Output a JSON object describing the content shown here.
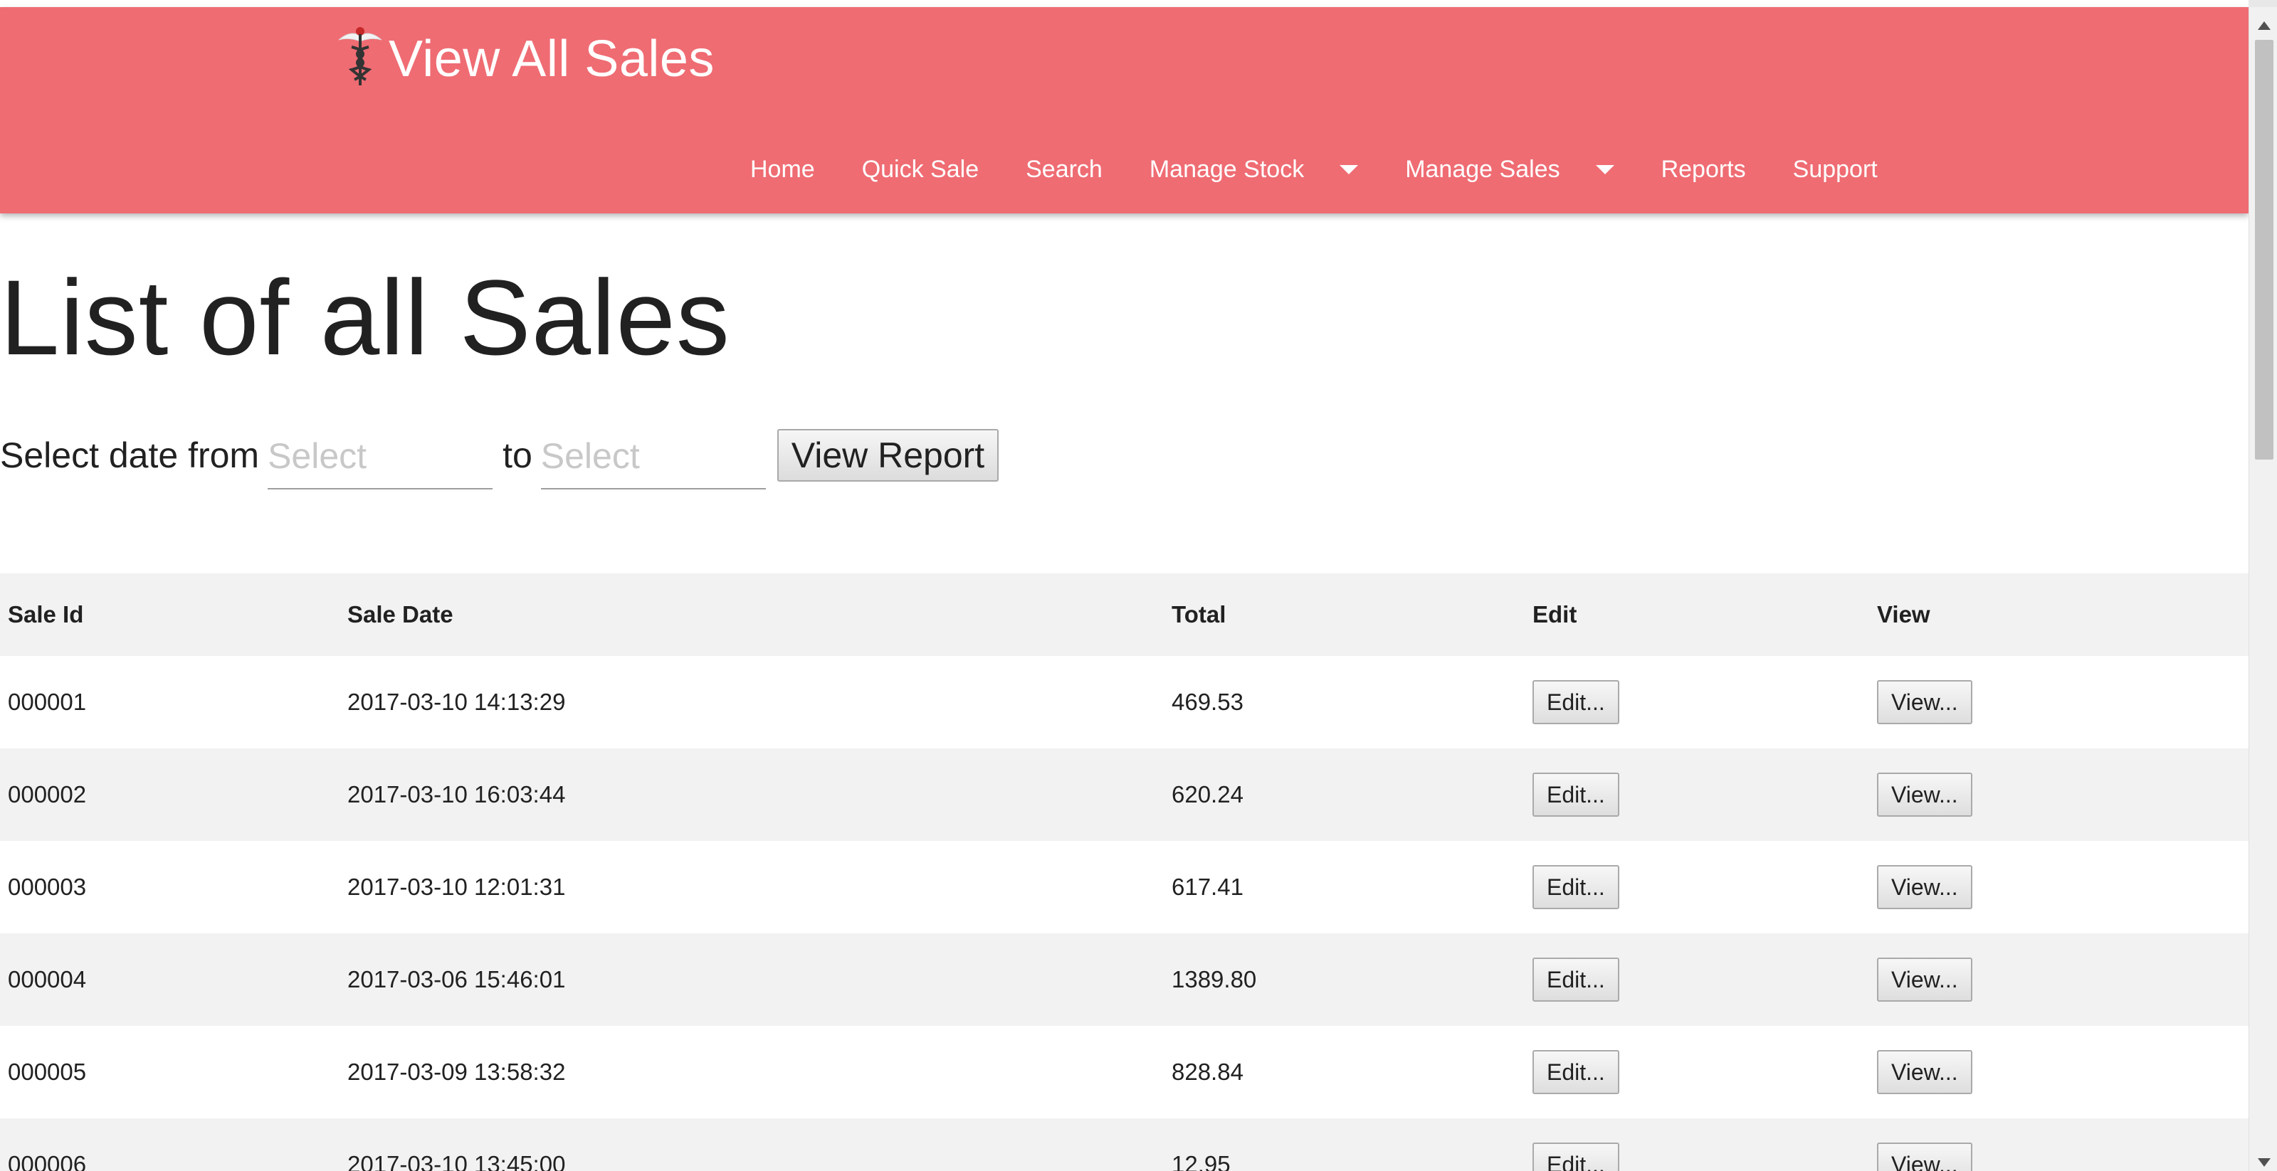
{
  "header": {
    "title": "View All Sales",
    "logo_icon": "caduceus-icon",
    "bg_color": "#ef6c73"
  },
  "nav": {
    "items": [
      {
        "label": "Home"
      },
      {
        "label": "Quick Sale"
      },
      {
        "label": "Search"
      },
      {
        "label": "Manage Stock",
        "dropdown": true
      },
      {
        "label": "Manage Sales",
        "dropdown": true
      },
      {
        "label": "Reports"
      },
      {
        "label": "Support"
      }
    ]
  },
  "main": {
    "heading": "List of all Sales",
    "filter": {
      "label_from": "Select date from",
      "from_placeholder": "Select",
      "label_to": "to",
      "to_placeholder": "Select",
      "button_label": "View Report"
    }
  },
  "table": {
    "columns": [
      "Sale Id",
      "Sale Date",
      "Total",
      "Edit",
      "View"
    ],
    "edit_label": "Edit...",
    "view_label": "View...",
    "rows": [
      {
        "id": "000001",
        "date": "2017-03-10 14:13:29",
        "total": "469.53"
      },
      {
        "id": "000002",
        "date": "2017-03-10 16:03:44",
        "total": "620.24"
      },
      {
        "id": "000003",
        "date": "2017-03-10 12:01:31",
        "total": "617.41"
      },
      {
        "id": "000004",
        "date": "2017-03-06 15:46:01",
        "total": "1389.80"
      },
      {
        "id": "000005",
        "date": "2017-03-09 13:58:32",
        "total": "828.84"
      },
      {
        "id": "000006",
        "date": "2017-03-10 13:45:00",
        "total": "12.95"
      }
    ]
  }
}
